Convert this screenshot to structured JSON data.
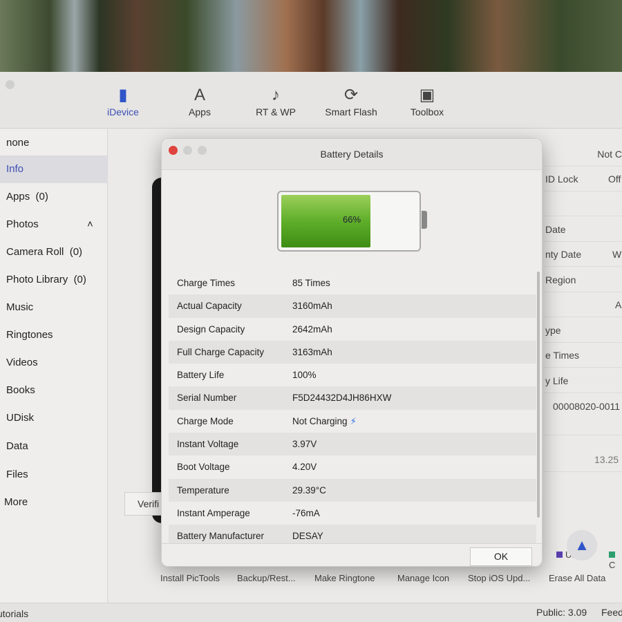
{
  "toolbar": {
    "items": [
      {
        "label": "iDevice",
        "icon": "phone-icon"
      },
      {
        "label": "Apps",
        "icon": "app-store-icon"
      },
      {
        "label": "RT & WP",
        "icon": "music-note-icon"
      },
      {
        "label": "Smart Flash",
        "icon": "flash-icon"
      },
      {
        "label": "Toolbox",
        "icon": "toolbox-icon"
      }
    ]
  },
  "sidebar": {
    "device": "none",
    "items": [
      {
        "label": "Info"
      },
      {
        "label": "Apps",
        "count": "(0)"
      },
      {
        "label": "Photos"
      },
      {
        "label": "Camera Roll",
        "count": "(0)"
      },
      {
        "label": "Photo Library",
        "count": "(0)"
      },
      {
        "label": "Music"
      },
      {
        "label": "Ringtones"
      },
      {
        "label": "Videos"
      },
      {
        "label": "Books"
      },
      {
        "label": "UDisk"
      },
      {
        "label": "Data"
      },
      {
        "label": "Files"
      },
      {
        "label": "More"
      }
    ]
  },
  "background_info": {
    "rows": [
      "ID Lock",
      "",
      "Date",
      "nty Date",
      "Region",
      "",
      "ype",
      "e Times",
      "y Life"
    ],
    "values": [
      "Not C",
      "Off",
      "W",
      "A"
    ],
    "serial": "00008020-0011",
    "storage": "13.25",
    "legend": [
      "UDisk",
      "C"
    ],
    "verify": "Verifi",
    "tools": [
      "Install PicTools",
      "Backup/Rest...",
      "Make Ringtone",
      "Manage Icon",
      "Stop iOS Upd...",
      "Erase All Data"
    ]
  },
  "status": {
    "left": "utorials",
    "version": "Public: 3.09",
    "feedback": "Feed"
  },
  "dialog": {
    "title": "Battery Details",
    "battery_percent": "66%",
    "battery_level": 66,
    "rows": [
      {
        "label": "Charge Times",
        "value": "85 Times"
      },
      {
        "label": "Actual Capacity",
        "value": "3160mAh"
      },
      {
        "label": "Design Capacity",
        "value": "2642mAh"
      },
      {
        "label": "Full Charge Capacity",
        "value": "3163mAh"
      },
      {
        "label": "Battery Life",
        "value": "100%"
      },
      {
        "label": "Serial Number",
        "value": "F5D24432D4JH86HXW"
      },
      {
        "label": "Charge Mode",
        "value": "Not Charging"
      },
      {
        "label": "Instant Voltage",
        "value": "3.97V"
      },
      {
        "label": "Boot Voltage",
        "value": "4.20V"
      },
      {
        "label": "Temperature",
        "value": "29.39°C"
      },
      {
        "label": "Instant Amperage",
        "value": "-76mA"
      },
      {
        "label": "Battery Manufacturer",
        "value": "DESAY"
      }
    ],
    "ok_label": "OK"
  },
  "colors": {
    "accent": "#3d4fb5",
    "battery_green": "#5fae2a",
    "close": "#e0443e"
  }
}
